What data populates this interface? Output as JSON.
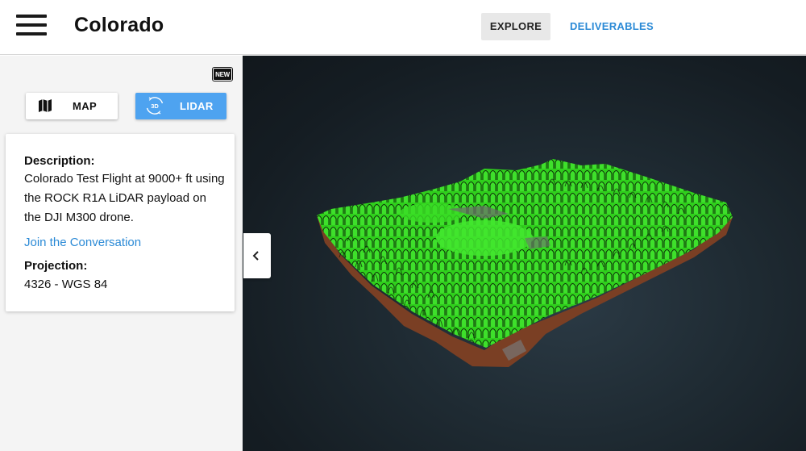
{
  "header": {
    "title": "Colorado",
    "tabs": [
      {
        "label": "EXPLORE",
        "active": true
      },
      {
        "label": "DELIVERABLES",
        "active": false
      }
    ]
  },
  "sidebar": {
    "new_badge": "NEW",
    "view_buttons": {
      "map_label": "MAP",
      "lidar_label": "LIDAR",
      "lidar_icon_text": "3D",
      "active": "LIDAR"
    },
    "info_card": {
      "description_heading": "Description:",
      "description_text": "Colorado Test Flight at 9000+ ft using the ROCK R1A LiDAR payload on the DJI M300 drone.",
      "link_text": "Join the Conversation",
      "projection_heading": "Projection:",
      "projection_value": "4326 - WGS 84"
    }
  },
  "viewer": {
    "collapse_icon": "chevron-left-icon",
    "content": "lidar-point-cloud"
  },
  "colors": {
    "accent_blue": "#4ea3f0",
    "link_blue": "#2b8ad6",
    "viewer_bg": "#1c262d",
    "canopy_green": "#34d11f",
    "terrain_brown": "#8b4a2b"
  }
}
